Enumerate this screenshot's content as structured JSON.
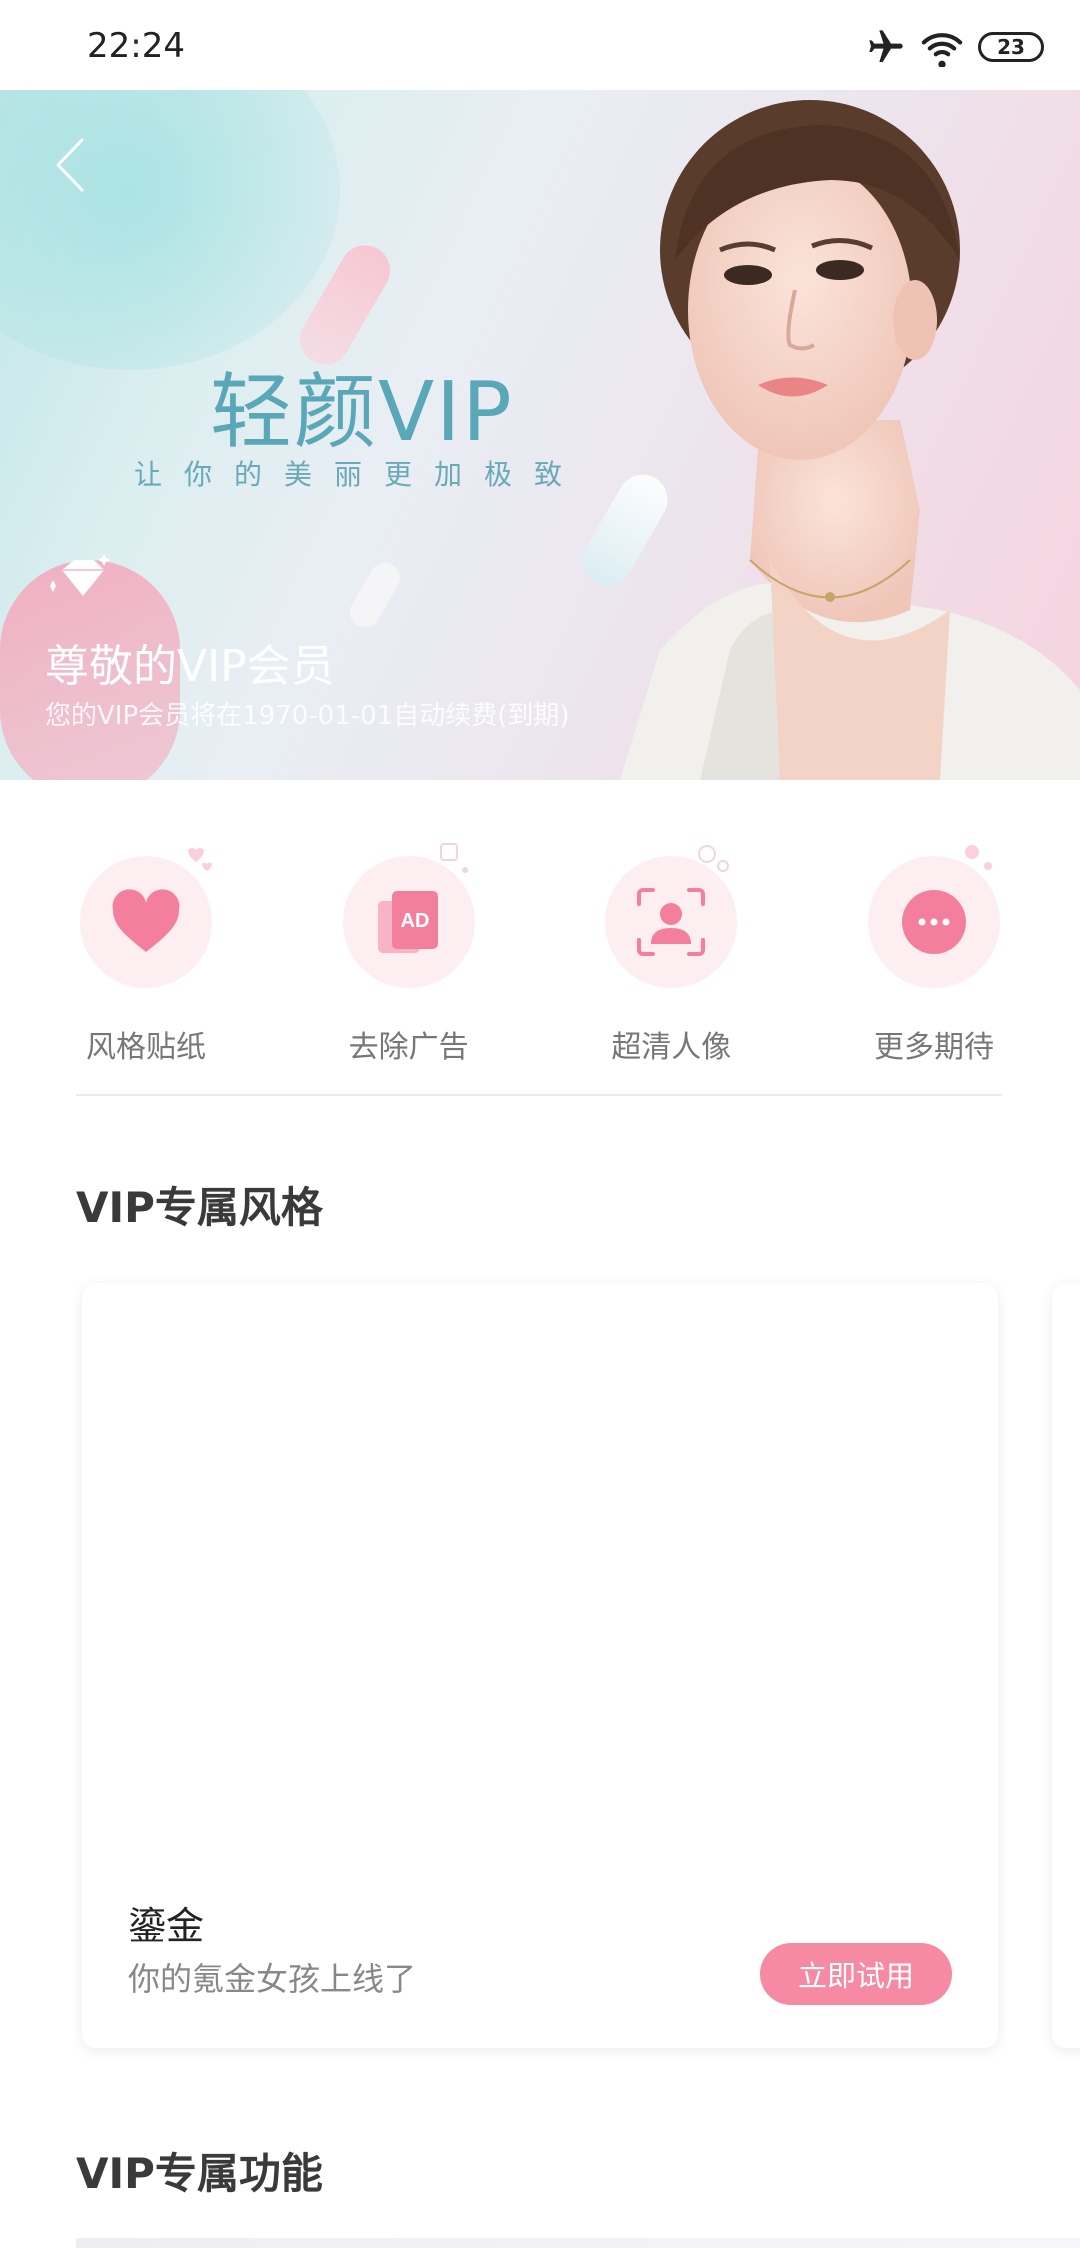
{
  "status_bar": {
    "time": "22:24",
    "battery": "23",
    "icons": [
      "airplane-icon",
      "wifi-icon",
      "battery-icon"
    ]
  },
  "hero": {
    "title": "轻颜VIP",
    "slogan": "让你的美丽更加极致",
    "member_title": "尊敬的VIP会员",
    "member_subtitle": "您的VIP会员将在1970-01-01自动续费(到期)"
  },
  "features": [
    {
      "label": "风格贴纸",
      "icon": "heart-icon"
    },
    {
      "label": "去除广告",
      "icon": "ad-icon"
    },
    {
      "label": "超清人像",
      "icon": "portrait-icon"
    },
    {
      "label": "更多期待",
      "icon": "more-icon"
    }
  ],
  "vip_styles": {
    "title": "VIP专属风格",
    "card": {
      "name": "鎏金",
      "description": "你的氪金女孩上线了",
      "button": "立即试用"
    }
  },
  "vip_functions": {
    "title": "VIP专属功能"
  },
  "colors": {
    "accent_pink": "#f68aa3",
    "icon_bg": "#fdeef2",
    "title_teal": "#5aa7b8"
  }
}
